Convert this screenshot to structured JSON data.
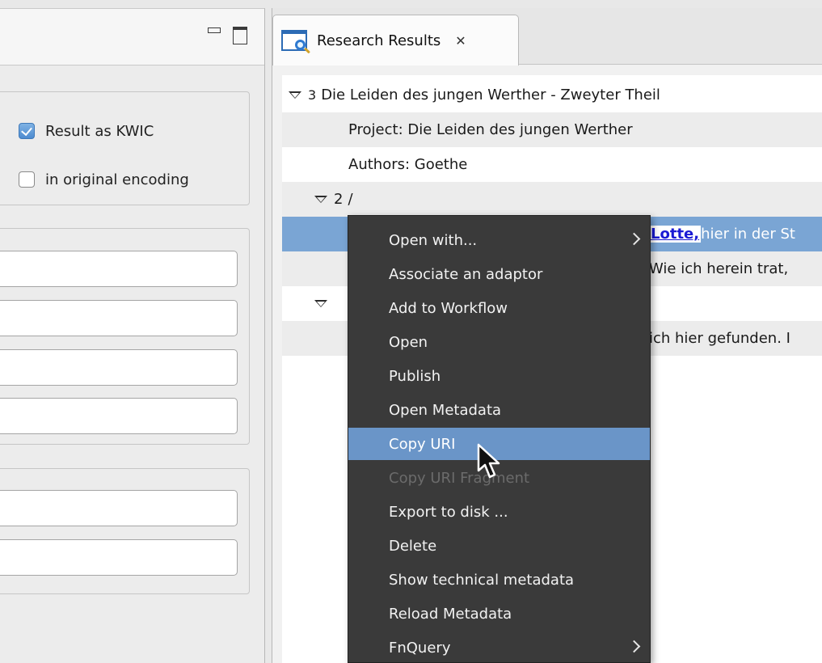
{
  "left_panel": {
    "options": [
      {
        "label": "Result as KWIC",
        "checked": true
      },
      {
        "label": "in original encoding",
        "checked": false
      }
    ],
    "group1_fields": [
      "",
      "",
      "",
      ""
    ],
    "group2_fields": [
      "",
      ""
    ]
  },
  "editor": {
    "tab": {
      "title": "Research Results",
      "close_glyph": "✕"
    },
    "tree": {
      "row0": {
        "index": "3",
        "title": "Die Leiden des jungen Werther - Zweyter Theil"
      },
      "row1": {
        "text": "Project: Die Leiden des jungen Werther"
      },
      "row2": {
        "text": "Authors: Goethe"
      },
      "row3": {
        "index": "2",
        "suffix": "/"
      },
      "row4": {
        "keyword": "Lotte,",
        "after": " hier in der St"
      },
      "row5": {
        "after": "Wie ich herein trat,"
      },
      "row7": {
        "after": "ich hier gefunden. I"
      }
    }
  },
  "context_menu": {
    "items": [
      {
        "label": "Open with...",
        "submenu": true
      },
      {
        "label": "Associate an adaptor"
      },
      {
        "label": "Add to Workflow"
      },
      {
        "label": "Open"
      },
      {
        "label": "Publish"
      },
      {
        "label": "Open Metadata"
      },
      {
        "label": "Copy URI",
        "active": true
      },
      {
        "label": "Copy URI Fragment",
        "disabled": true
      },
      {
        "label": "Export to disk ..."
      },
      {
        "label": "Delete"
      },
      {
        "label": "Show technical metadata"
      },
      {
        "label": "Reload Metadata"
      },
      {
        "label": "FnQuery",
        "submenu": true
      }
    ]
  },
  "colors": {
    "selection": "#7aa5d4",
    "menu_bg": "#3a3a3a",
    "menu_active": "#6a95c8",
    "keyword": "#1a1ad4"
  }
}
